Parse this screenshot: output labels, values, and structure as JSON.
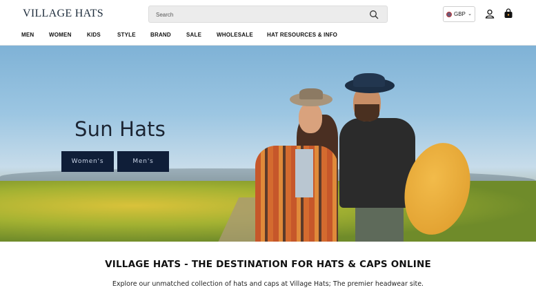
{
  "header": {
    "logo": "VILLAGE HATS",
    "search": {
      "placeholder": "Search"
    },
    "currency": {
      "code": "GBP"
    }
  },
  "nav": {
    "items": [
      {
        "label": "MEN"
      },
      {
        "label": "WOMEN"
      },
      {
        "label": "KIDS"
      },
      {
        "label": "STYLE"
      },
      {
        "label": "BRAND"
      },
      {
        "label": "SALE"
      },
      {
        "label": "WHOLESALE"
      },
      {
        "label": "HAT RESOURCES & INFO"
      }
    ]
  },
  "hero": {
    "title": "Sun Hats",
    "buttons": [
      {
        "label": "Women's"
      },
      {
        "label": "Men's"
      }
    ]
  },
  "intro": {
    "title": "VILLAGE HATS - THE DESTINATION FOR HATS & CAPS ONLINE",
    "text": "Explore our unmatched collection of hats and caps at Village Hats; The premier headwear site."
  },
  "colors": {
    "accent": "#0f1e38",
    "brand": "#1c2b3a"
  },
  "icons": [
    "search-icon",
    "user-icon",
    "shopping-bag-icon",
    "chevron-down-icon"
  ]
}
